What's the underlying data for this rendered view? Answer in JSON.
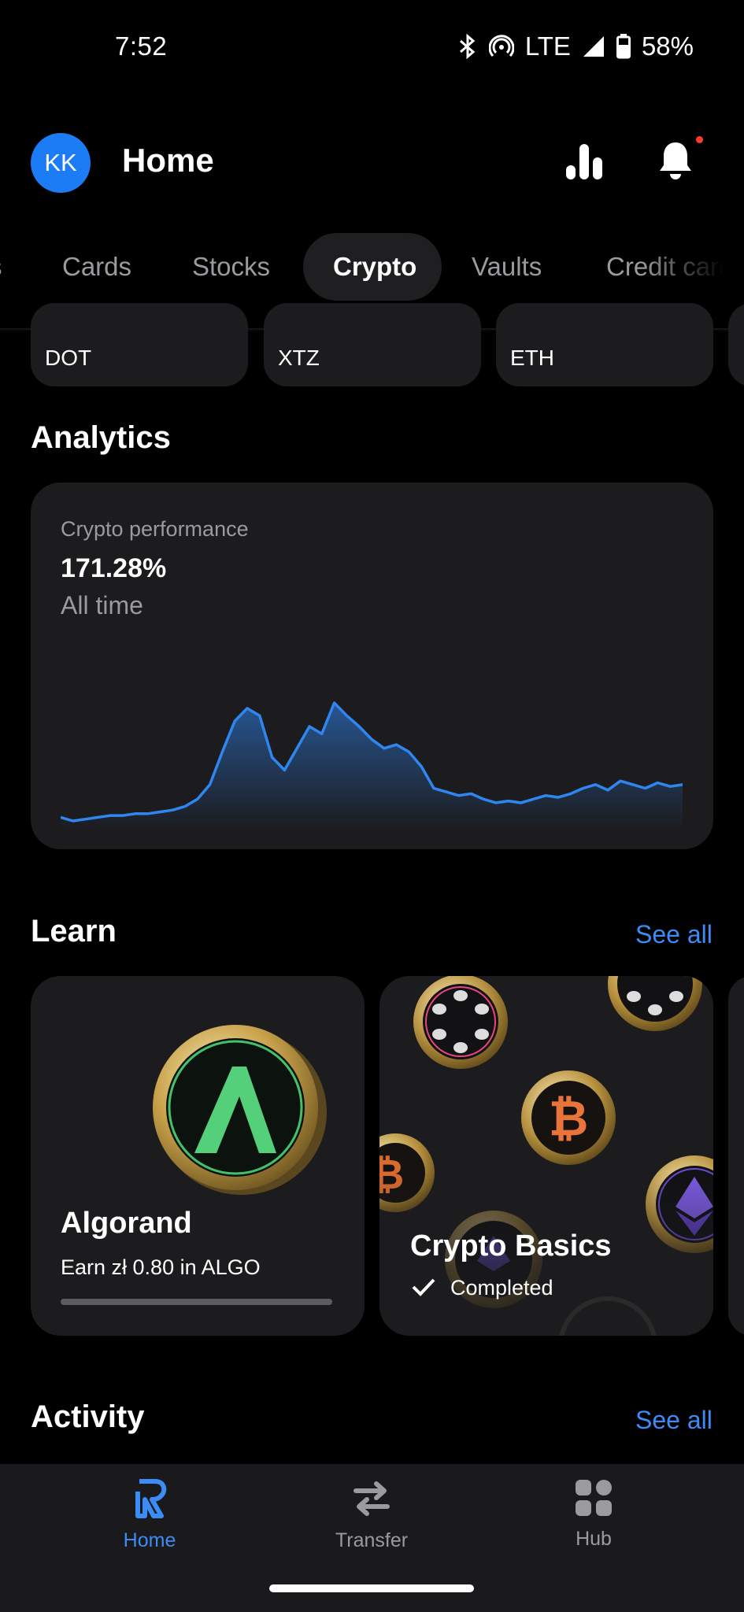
{
  "status_bar": {
    "time": "7:52",
    "network": "LTE",
    "battery": "58%"
  },
  "header": {
    "avatar_initials": "KK",
    "title": "Home"
  },
  "tabs": [
    {
      "label": "s"
    },
    {
      "label": "Cards"
    },
    {
      "label": "Stocks"
    },
    {
      "label": "Crypto",
      "active": true
    },
    {
      "label": "Vaults"
    },
    {
      "label": "Credit card"
    }
  ],
  "assets": [
    {
      "label": "DOT"
    },
    {
      "label": "XTZ"
    },
    {
      "label": "ETH"
    }
  ],
  "analytics": {
    "section_title": "Analytics",
    "label": "Crypto performance",
    "value": "171.28%",
    "period": "All time"
  },
  "chart_data": {
    "type": "area",
    "x": [
      0,
      1,
      2,
      3,
      4,
      5,
      6,
      7,
      8,
      9,
      10,
      11,
      12,
      13,
      14,
      15,
      16,
      17,
      18,
      19,
      20,
      21,
      22,
      23,
      24,
      25,
      26,
      27,
      28,
      29,
      30,
      31,
      32,
      33,
      34,
      35,
      36,
      37,
      38,
      39,
      40,
      41,
      42,
      43,
      44,
      45,
      46,
      47,
      48,
      49,
      50
    ],
    "values": [
      2,
      0,
      1,
      2,
      3,
      3,
      4,
      4,
      5,
      6,
      8,
      12,
      20,
      38,
      55,
      62,
      58,
      35,
      28,
      40,
      52,
      48,
      65,
      58,
      52,
      45,
      40,
      42,
      38,
      30,
      18,
      16,
      14,
      15,
      12,
      10,
      11,
      10,
      12,
      14,
      13,
      15,
      18,
      20,
      17,
      22,
      20,
      18,
      21,
      19,
      20
    ],
    "color": "#2f86f0",
    "grid": false
  },
  "learn": {
    "section_title": "Learn",
    "see_all": "See all",
    "cards": [
      {
        "title": "Algorand",
        "subtitle": "Earn zł 0.80 in ALGO",
        "progress": 0.0
      },
      {
        "title": "Crypto Basics",
        "status": "Completed"
      }
    ]
  },
  "activity": {
    "section_title": "Activity",
    "see_all": "See all"
  },
  "bottom_nav": [
    {
      "label": "Home",
      "icon": "revolut-logo-icon",
      "active": true
    },
    {
      "label": "Transfer",
      "icon": "transfer-arrows-icon"
    },
    {
      "label": "Hub",
      "icon": "grid-icon"
    }
  ],
  "colors": {
    "accent": "#3b8cf7",
    "avatar": "#1b7cf5",
    "card": "#1c1c1f",
    "background": "#000000"
  }
}
